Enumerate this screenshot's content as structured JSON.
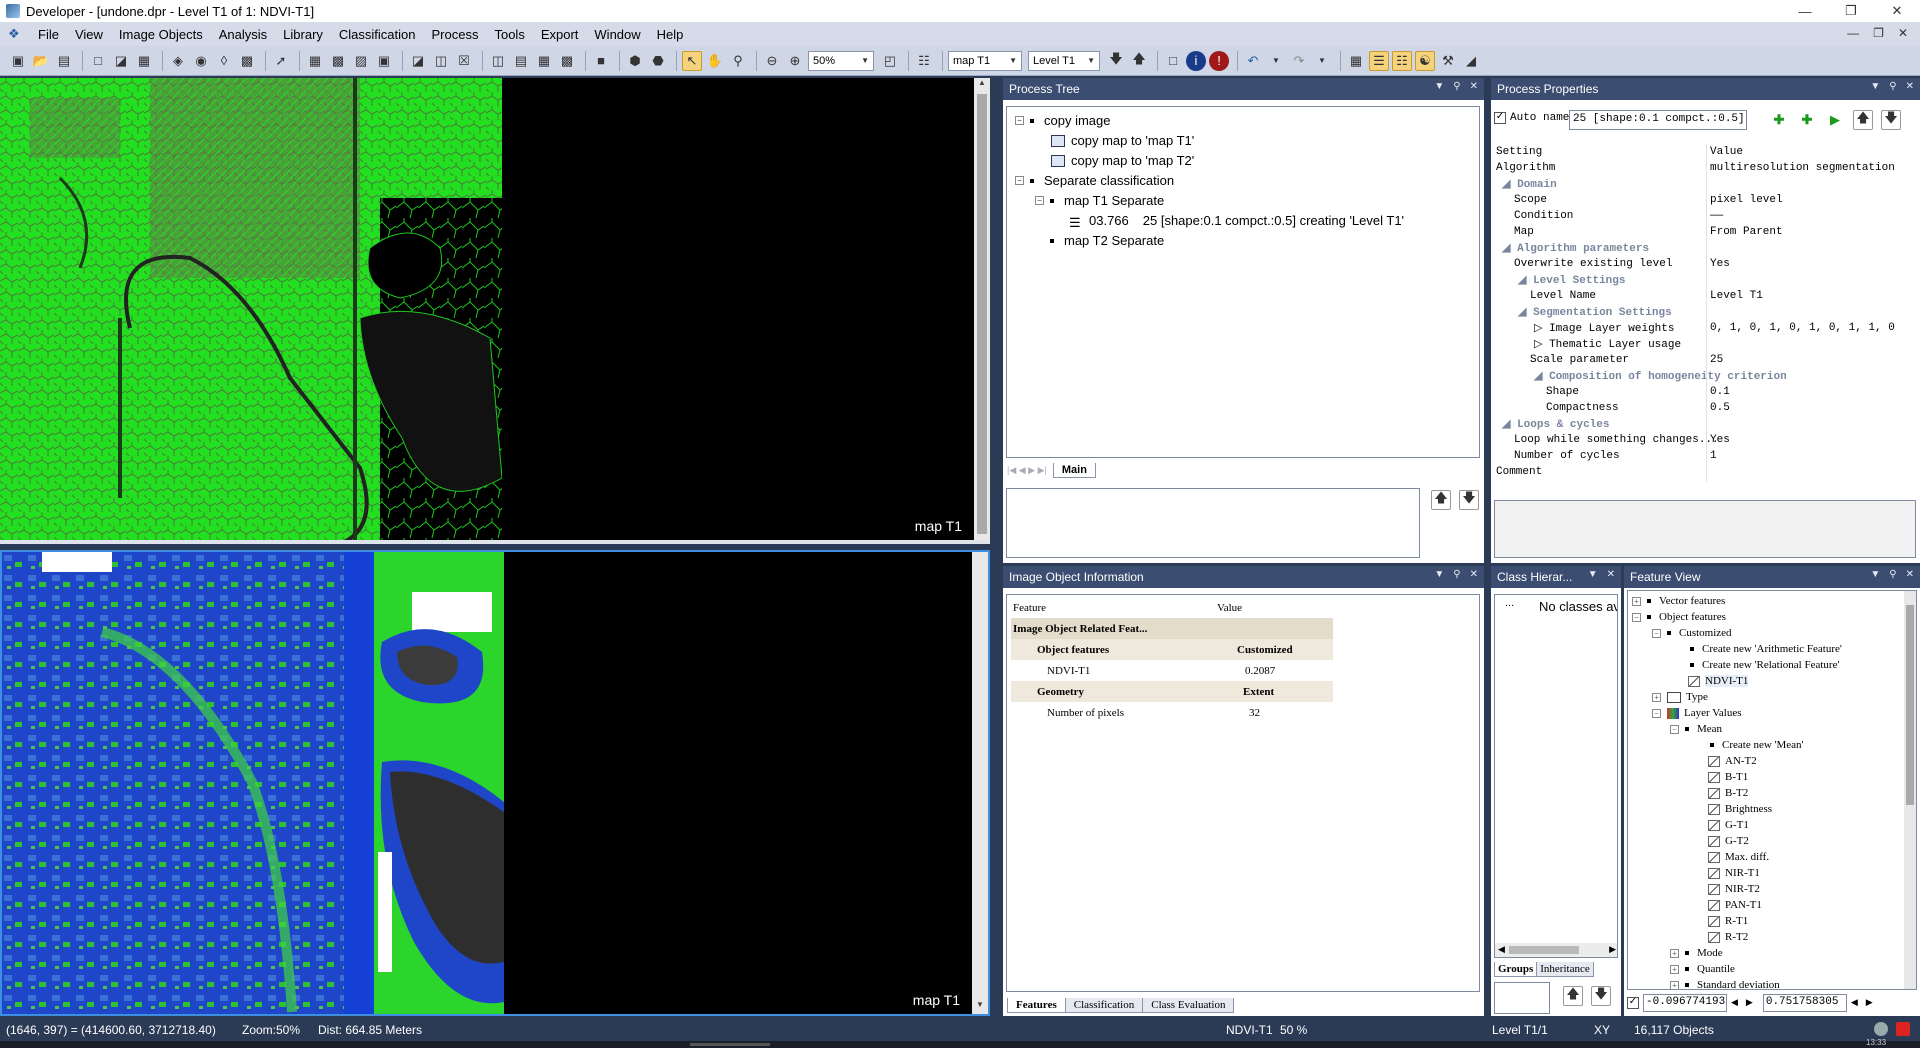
{
  "window": {
    "title": "Developer - [undone.dpr - Level T1 of 1: NDVI-T1]"
  },
  "menu": [
    "File",
    "View",
    "Image Objects",
    "Analysis",
    "Library",
    "Classification",
    "Process",
    "Tools",
    "Export",
    "Window",
    "Help"
  ],
  "toolbar": {
    "zoom": "50%",
    "map": "map T1",
    "level": "Level T1"
  },
  "maps": {
    "top_label": "map T1",
    "bottom_label": "map T1"
  },
  "process_tree": {
    "title": "Process Tree",
    "items": {
      "copy_image": "copy image",
      "copy_t1": "copy map to 'map T1'",
      "copy_t2": "copy map to 'map T2'",
      "separate": "Separate classification",
      "t1_sep": "map T1 Separate",
      "seg_time": "03.766",
      "seg_text": "25 [shape:0.1 compct.:0.5] creating 'Level T1'",
      "t2_sep": "map T2 Separate"
    },
    "tab": "Main"
  },
  "process_properties": {
    "title": "Process Properties",
    "auto_name_label": "Auto name",
    "name_value": "25 [shape:0.1 compct.:0.5] creating 'Level T1'",
    "header": {
      "setting": "Setting",
      "value": "Value"
    },
    "rows": [
      {
        "k": "Algorithm",
        "v": "multiresolution segmentation"
      },
      {
        "k": "Domain",
        "v": ""
      },
      {
        "k": "Scope",
        "v": "pixel level"
      },
      {
        "k": "Condition",
        "v": "——"
      },
      {
        "k": "Map",
        "v": "From Parent"
      },
      {
        "k": "Algorithm parameters",
        "v": ""
      },
      {
        "k": "Overwrite existing level",
        "v": "Yes"
      },
      {
        "k": "Level Settings",
        "v": ""
      },
      {
        "k": "Level Name",
        "v": "Level T1"
      },
      {
        "k": "Segmentation Settings",
        "v": ""
      },
      {
        "k": "Image Layer weights",
        "v": "0, 1, 0, 1, 0, 1, 0, 1, 1, 0"
      },
      {
        "k": "Thematic Layer usage",
        "v": ""
      },
      {
        "k": "Scale parameter",
        "v": "25"
      },
      {
        "k": "Composition of homogeneity criterion",
        "v": ""
      },
      {
        "k": "Shape",
        "v": "0.1"
      },
      {
        "k": "Compactness",
        "v": "0.5"
      },
      {
        "k": "Loops & cycles",
        "v": ""
      },
      {
        "k": "Loop while something changes...",
        "v": "Yes"
      },
      {
        "k": "Number of cycles",
        "v": "1"
      },
      {
        "k": "Comment",
        "v": ""
      }
    ]
  },
  "image_object_info": {
    "title": "Image Object Information",
    "header": {
      "feature": "Feature",
      "value": "Value"
    },
    "rows": [
      {
        "k": "Image Object Related Feat...",
        "v": ""
      },
      {
        "k": "Object features",
        "v": "Customized"
      },
      {
        "k": "NDVI-T1",
        "v": "0.2087"
      },
      {
        "k": "Geometry",
        "v": "Extent"
      },
      {
        "k": "Number of pixels",
        "v": "32"
      }
    ],
    "tabs": [
      "Features",
      "Classification",
      "Class Evaluation"
    ]
  },
  "class_hierarchy": {
    "title": "Class Hierar...",
    "empty": "No classes av",
    "dots": "...",
    "tabs": [
      "Groups",
      "Inheritance"
    ]
  },
  "feature_view": {
    "title": "Feature View",
    "items": {
      "vector": "Vector features",
      "object": "Object features",
      "customized": "Customized",
      "new_arith": "Create new 'Arithmetic Feature'",
      "new_rel": "Create new 'Relational Feature'",
      "ndvi": "NDVI-T1",
      "type": "Type",
      "layer_values": "Layer Values",
      "mean": "Mean",
      "new_mean": "Create new 'Mean'",
      "mode": "Mode",
      "quantile": "Quantile",
      "std": "Standard deviation"
    },
    "mean_items": [
      "AN-T2",
      "B-T1",
      "B-T2",
      "Brightness",
      "G-T1",
      "G-T2",
      "Max. diff.",
      "NIR-T1",
      "NIR-T2",
      "PAN-T1",
      "R-T1",
      "R-T2"
    ],
    "range_min": "-0.096774193",
    "range_max": "0.751758305"
  },
  "status": {
    "coords": "(1646, 397) = (414600.60, 3712718.40)",
    "zoom": "Zoom:50%",
    "dist": "Dist: 664.85 Meters",
    "layer": "NDVI-T1",
    "pct": "50 %",
    "level": "Level T1/1",
    "xy": "XY",
    "objects": "16,117 Objects",
    "time": "13:33"
  },
  "colors": {
    "panel_header": "#3b4d70",
    "accent": "#3f8fe0",
    "segment_green": "#1ee81e"
  }
}
